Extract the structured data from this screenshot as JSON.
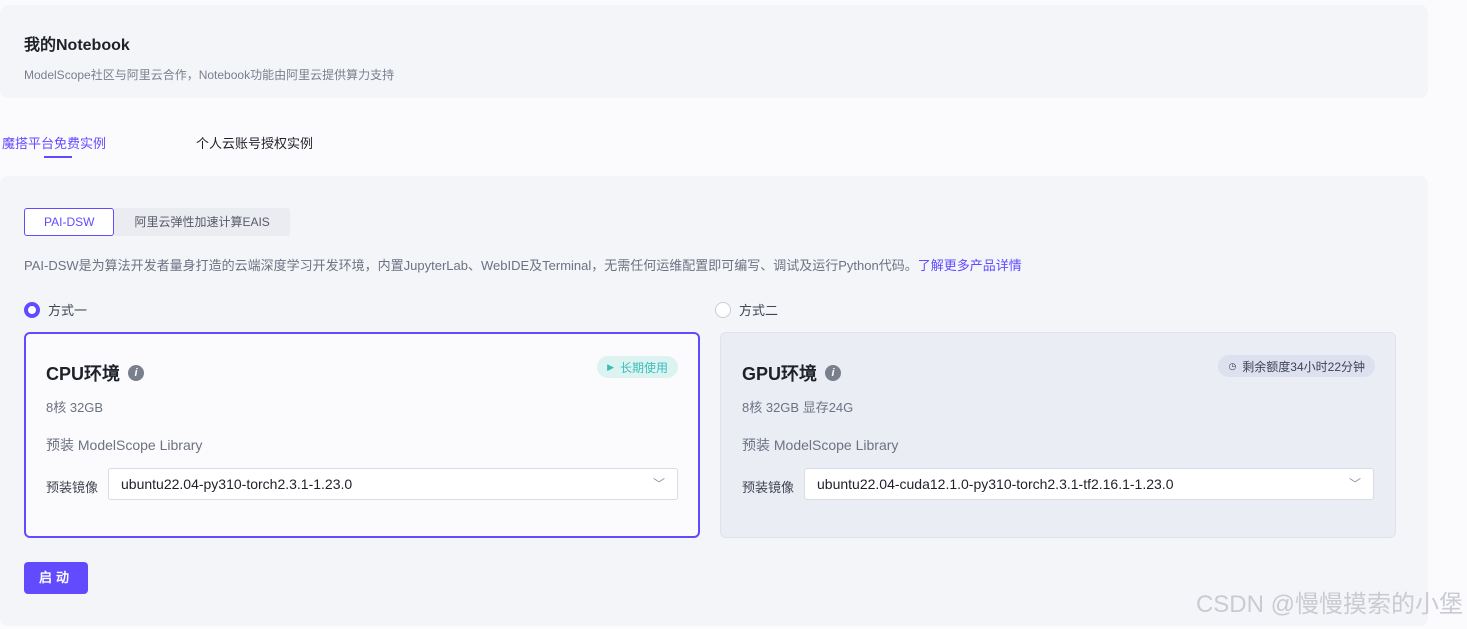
{
  "header": {
    "title": "我的Notebook",
    "subtitle": "ModelScope社区与阿里云合作，Notebook功能由阿里云提供算力支持"
  },
  "tabs": [
    {
      "label": "魔搭平台免费实例",
      "active": true
    },
    {
      "label": "个人云账号授权实例",
      "active": false
    }
  ],
  "segments": [
    {
      "label": "PAI-DSW",
      "active": true
    },
    {
      "label": "阿里云弹性加速计算EAIS",
      "active": false
    }
  ],
  "description": {
    "text": "PAI-DSW是为算法开发者量身打造的云端深度学习开发环境，内置JupyterLab、WebIDE及Terminal，无需任何运维配置即可编写、调试及运行Python代码。",
    "link": "了解更多产品详情"
  },
  "options": [
    {
      "label": "方式一",
      "selected": true
    },
    {
      "label": "方式二",
      "selected": false
    }
  ],
  "cards": [
    {
      "title": "CPU环境",
      "badge": "长期使用",
      "spec": "8核 32GB",
      "library": "预装 ModelScope Library",
      "image_label": "预装镜像",
      "image_value": "ubuntu22.04-py310-torch2.3.1-1.23.0"
    },
    {
      "title": "GPU环境",
      "badge": "剩余额度34小时22分钟",
      "spec": "8核 32GB 显存24G",
      "library": "预装 ModelScope Library",
      "image_label": "预装镜像",
      "image_value": "ubuntu22.04-cuda12.1.0-py310-torch2.3.1-tf2.16.1-1.23.0"
    }
  ],
  "launch_label": "启动",
  "watermark": "CSDN @慢慢摸索的小堡",
  "colors": {
    "accent": "#624aff",
    "cpu_badge": "#3bbdb8"
  }
}
